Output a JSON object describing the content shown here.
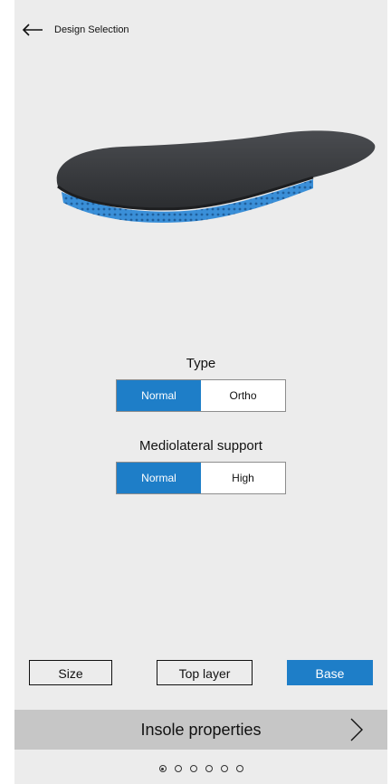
{
  "header": {
    "title": "Design Selection"
  },
  "type_group": {
    "label": "Type",
    "options": [
      "Normal",
      "Ortho"
    ],
    "selected": "Normal"
  },
  "support_group": {
    "label": "Mediolateral support",
    "options": [
      "Normal",
      "High"
    ],
    "selected": "Normal"
  },
  "bottom_buttons": {
    "size": "Size",
    "top_layer": "Top layer",
    "base": "Base",
    "active": "Base"
  },
  "properties_bar": {
    "label": "Insole properties"
  },
  "pager": {
    "count": 6,
    "active_index": 0
  },
  "colors": {
    "accent": "#1e7ec8",
    "background": "#ececec",
    "bar": "#c6c6c6",
    "insole_top": "#3a3c3f",
    "insole_base": "#3a8fd8"
  }
}
